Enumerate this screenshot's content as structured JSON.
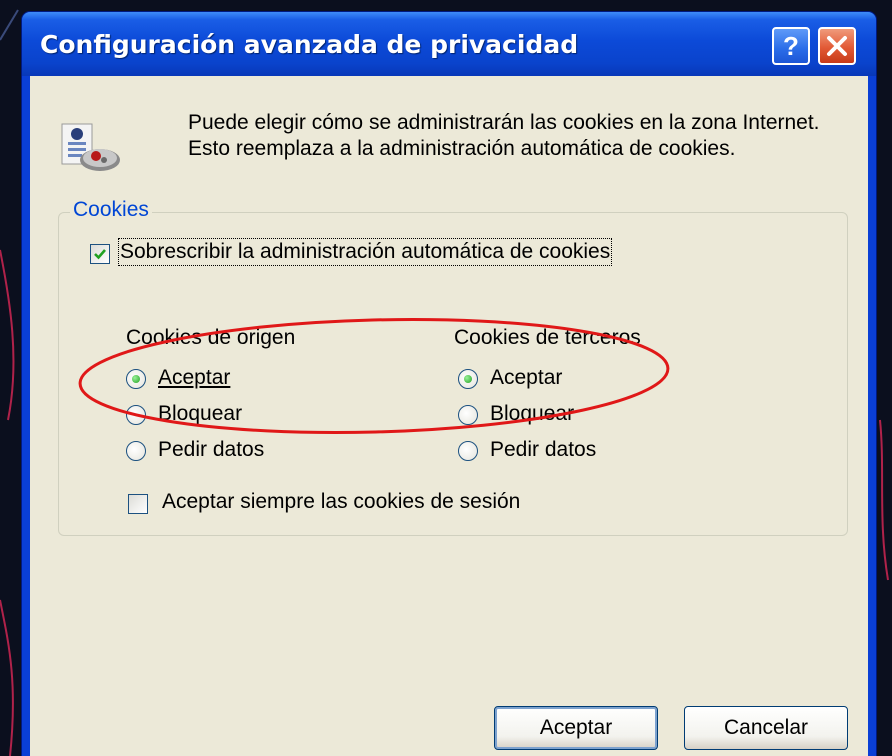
{
  "window": {
    "title": "Configuración avanzada de privacidad",
    "help_label": "?",
    "accent_color": "#0a3fd6",
    "close_color": "#e25a36"
  },
  "intro": {
    "icon": "privacy-cookie-icon",
    "text": "Puede elegir cómo se administrarán las cookies en la zona Internet. Esto reemplaza a la administración automática de cookies."
  },
  "cookies_group": {
    "label": "Cookies",
    "override": {
      "label": "Sobrescribir la administración automática de cookies",
      "checked": true
    },
    "first_party": {
      "heading": "Cookies de origen",
      "options": [
        {
          "label": "Aceptar",
          "selected": true
        },
        {
          "label": "Bloquear",
          "selected": false
        },
        {
          "label": "Pedir datos",
          "selected": false
        }
      ]
    },
    "third_party": {
      "heading": "Cookies de terceros",
      "options": [
        {
          "label": "Aceptar",
          "selected": true
        },
        {
          "label": "Bloquear",
          "selected": false
        },
        {
          "label": "Pedir datos",
          "selected": false
        }
      ]
    },
    "session": {
      "label": "Aceptar siempre las cookies de sesión",
      "checked": false
    }
  },
  "annotation": {
    "color": "#e01818"
  },
  "buttons": {
    "ok": "Aceptar",
    "cancel": "Cancelar"
  }
}
